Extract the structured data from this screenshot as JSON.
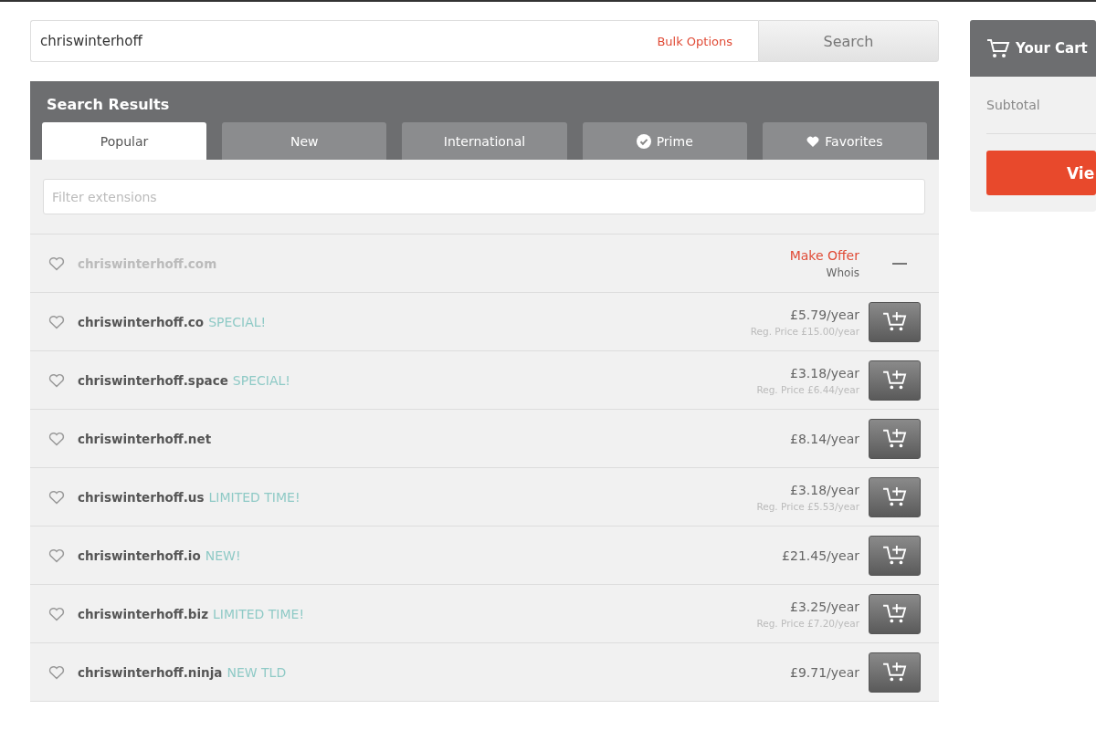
{
  "search": {
    "value": "chriswinterhoff",
    "bulk_link": "Bulk Options",
    "button": "Search"
  },
  "results": {
    "title": "Search Results",
    "tabs": [
      {
        "label": "Popular",
        "selected": true,
        "kind": "text"
      },
      {
        "label": "New",
        "selected": false,
        "kind": "text"
      },
      {
        "label": "International",
        "selected": false,
        "kind": "text"
      },
      {
        "label": "Prime",
        "selected": false,
        "kind": "check"
      },
      {
        "label": "Favorites",
        "selected": false,
        "kind": "heart"
      }
    ],
    "filter": {
      "placeholder": "Filter extensions"
    },
    "rows": [
      {
        "kind": "taken",
        "domain": "chriswinterhoff.com",
        "offer": "Make Offer",
        "whois": "Whois"
      },
      {
        "kind": "available",
        "domain": "chriswinterhoff.co",
        "tag": "SPECIAL!",
        "price": "£5.79/year",
        "reg_price": "Reg. Price £15.00/year"
      },
      {
        "kind": "available",
        "domain": "chriswinterhoff.space",
        "tag": "SPECIAL!",
        "price": "£3.18/year",
        "reg_price": "Reg. Price £6.44/year"
      },
      {
        "kind": "available",
        "domain": "chriswinterhoff.net",
        "price": "£8.14/year"
      },
      {
        "kind": "available",
        "domain": "chriswinterhoff.us",
        "tag": "LIMITED TIME!",
        "price": "£3.18/year",
        "reg_price": "Reg. Price £5.53/year"
      },
      {
        "kind": "available",
        "domain": "chriswinterhoff.io",
        "tag": "NEW!",
        "price": "£21.45/year"
      },
      {
        "kind": "available",
        "domain": "chriswinterhoff.biz",
        "tag": "LIMITED TIME!",
        "price": "£3.25/year",
        "reg_price": "Reg. Price £7.20/year"
      },
      {
        "kind": "available",
        "domain": "chriswinterhoff.ninja",
        "tag": "NEW TLD",
        "price": "£9.71/year"
      }
    ]
  },
  "cart": {
    "title": "Your Cart",
    "subtotal_label": "Subtotal",
    "button": "Vie"
  }
}
